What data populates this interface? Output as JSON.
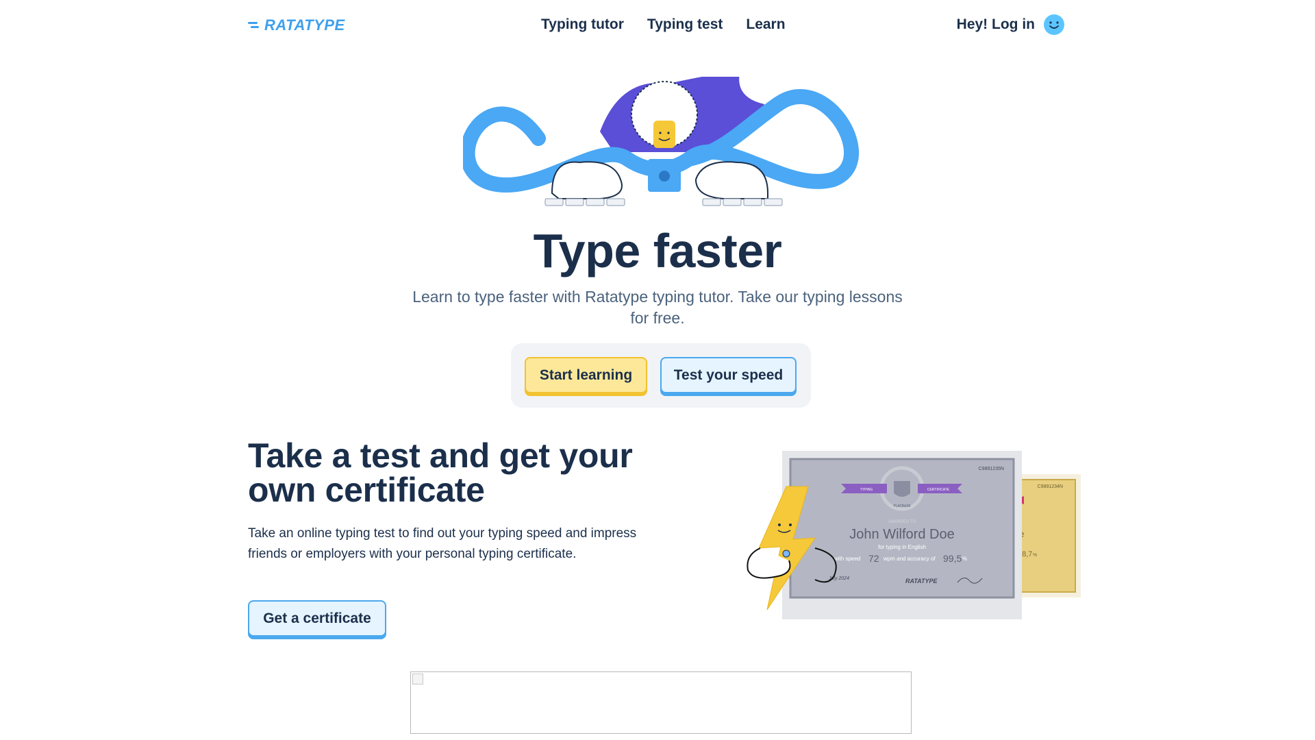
{
  "header": {
    "logo_text": "RATATYPE",
    "nav": [
      {
        "label": "Typing tutor"
      },
      {
        "label": "Typing test"
      },
      {
        "label": "Learn"
      }
    ],
    "login_label": "Hey! Log in"
  },
  "hero": {
    "title": "Type faster",
    "subtitle": "Learn to type faster with Ratatype typing tutor. Take our typing lessons for free.",
    "start_button": "Start learning",
    "test_button": "Test your speed"
  },
  "certificate_section": {
    "title": "Take a test and get your own certificate",
    "text": "Take an online typing test to find out your typing speed and impress friends or employers with your personal typing certificate.",
    "button": "Get a certificate",
    "certificate": {
      "id": "C9891235N",
      "ribbon_left": "TYPING",
      "ribbon_right": "CERTIFICATE",
      "level": "PLATINUM",
      "awarded_to": "AWARDED TO",
      "name": "John Wilford Doe",
      "language": "for typing in English",
      "speed_prefix": "with speed",
      "speed": "72",
      "speed_unit": "wpm and accuracy of",
      "accuracy": "99,5",
      "accuracy_unit": "%",
      "date": "July 2024",
      "brand": "RATATYPE"
    },
    "back_certificate": {
      "id": "C9891234N",
      "name_fragment": "oe",
      "accuracy": "98,7",
      "accuracy_unit": "%"
    }
  },
  "colors": {
    "brand_blue": "#3da0ee",
    "navy": "#1b2f4b",
    "yellow_button": "#fde89a",
    "yellow_border": "#f2c230",
    "blue_button": "#e6f4ff"
  }
}
